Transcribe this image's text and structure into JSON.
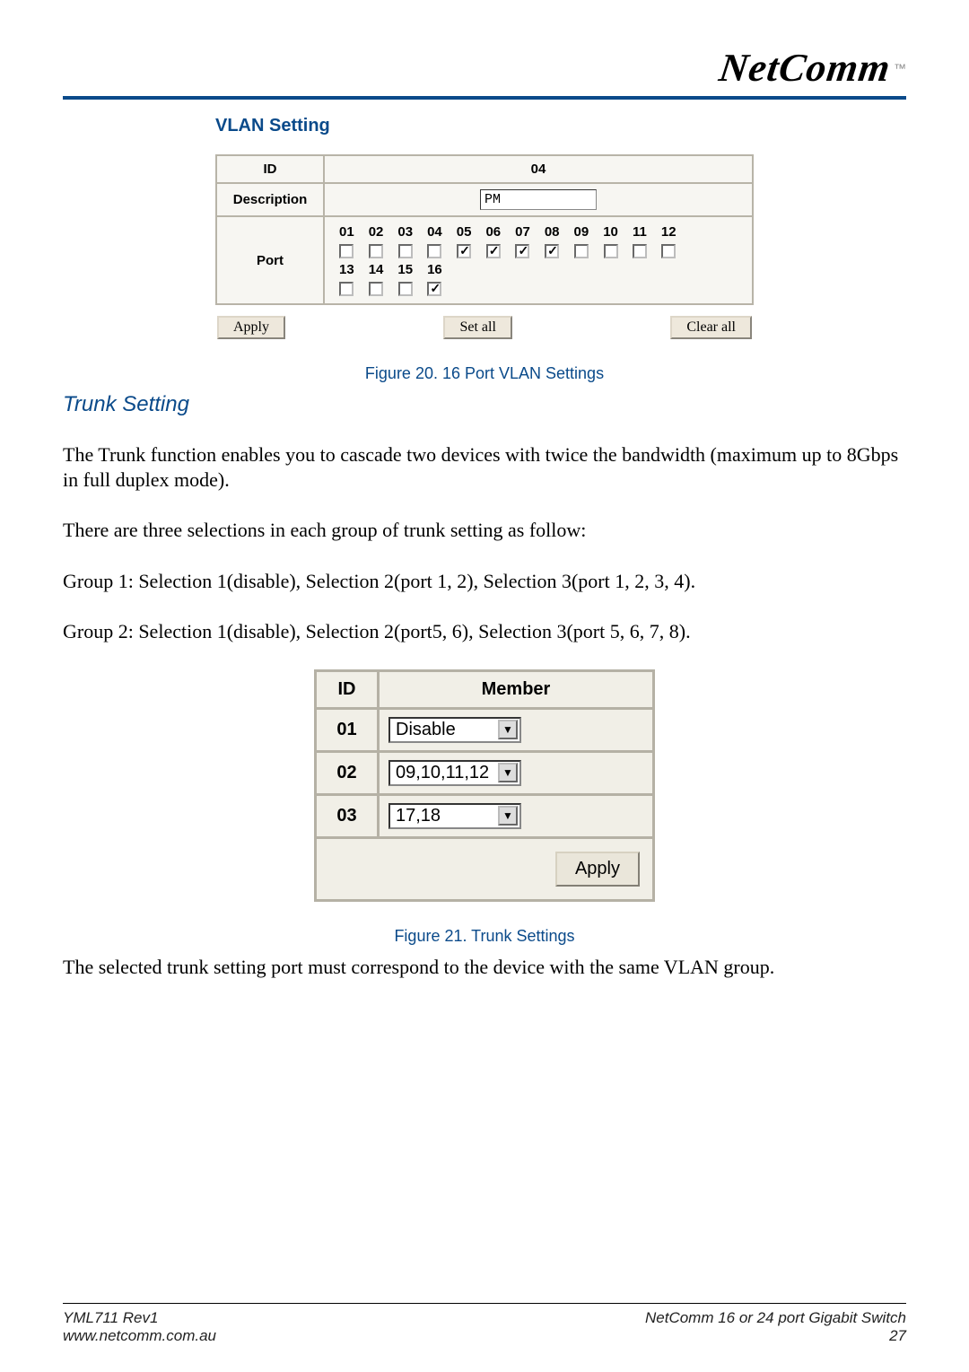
{
  "header": {
    "logo_text": "NetComm",
    "trademark": "™"
  },
  "vlan": {
    "panel_title": "VLAN Setting",
    "id_label": "ID",
    "id_value": "04",
    "description_label": "Description",
    "description_value": "PM",
    "port_label": "Port",
    "ports_top": {
      "numbers": [
        "01",
        "02",
        "03",
        "04",
        "05",
        "06",
        "07",
        "08",
        "09",
        "10",
        "11",
        "12"
      ],
      "checked": [
        false,
        false,
        false,
        false,
        true,
        true,
        true,
        true,
        false,
        false,
        false,
        false
      ]
    },
    "ports_bottom": {
      "numbers": [
        "13",
        "14",
        "15",
        "16"
      ],
      "checked": [
        false,
        false,
        false,
        true
      ]
    },
    "buttons": {
      "apply": "Apply",
      "set_all": "Set all",
      "clear_all": "Clear all"
    },
    "caption": "Figure 20. 16 Port VLAN Settings"
  },
  "trunk_section": {
    "title": "Trunk Setting",
    "para1": "The Trunk function enables you to cascade two devices with twice the bandwidth (maximum up to 8Gbps in full duplex mode).",
    "para2": "There are three selections in each group of trunk setting as follow:",
    "para3": "Group 1: Selection 1(disable), Selection 2(port 1, 2), Selection 3(port 1, 2, 3, 4).",
    "para4": "Group 2: Selection 1(disable), Selection 2(port5, 6), Selection 3(port 5, 6, 7, 8)."
  },
  "trunk_shot": {
    "id_header": "ID",
    "member_header": "Member",
    "rows": [
      {
        "id": "01",
        "value": "Disable"
      },
      {
        "id": "02",
        "value": "09,10,11,12"
      },
      {
        "id": "03",
        "value": "17,18"
      }
    ],
    "apply": "Apply",
    "caption": "Figure 21. Trunk Settings"
  },
  "closing_para": "The selected trunk setting port must correspond to the device with the same VLAN group.",
  "footer": {
    "left_line1": "YML711 Rev1",
    "left_line2": "www.netcomm.com.au",
    "right_line1": "NetComm 16 or 24 port Gigabit Switch",
    "right_line2": "27"
  }
}
